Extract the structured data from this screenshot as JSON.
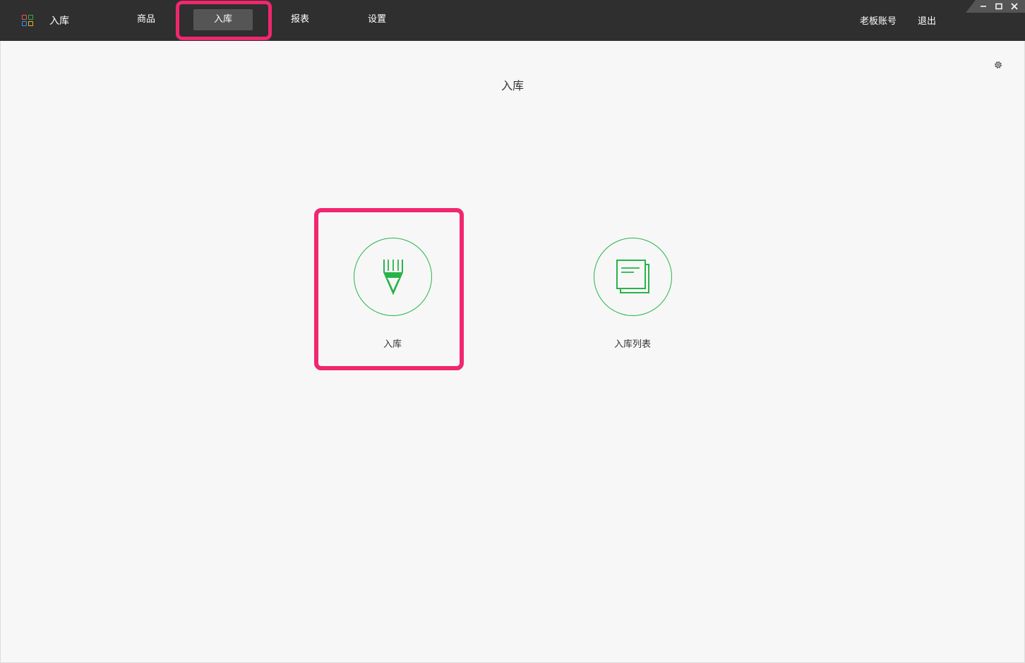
{
  "app": {
    "name": "入库"
  },
  "nav": {
    "items": [
      {
        "label": "商品"
      },
      {
        "label": "入库"
      },
      {
        "label": "报表"
      },
      {
        "label": "设置"
      }
    ],
    "active_index": 1
  },
  "account": {
    "label": "老板账号",
    "logout": "退出"
  },
  "page": {
    "title": "入库"
  },
  "tiles": [
    {
      "label": "入库",
      "icon": "pen-icon"
    },
    {
      "label": "入库列表",
      "icon": "document-list-icon"
    }
  ],
  "colors": {
    "accent": "#28b34a",
    "highlight": "#f0276e",
    "topbar": "#2f2f2f"
  }
}
